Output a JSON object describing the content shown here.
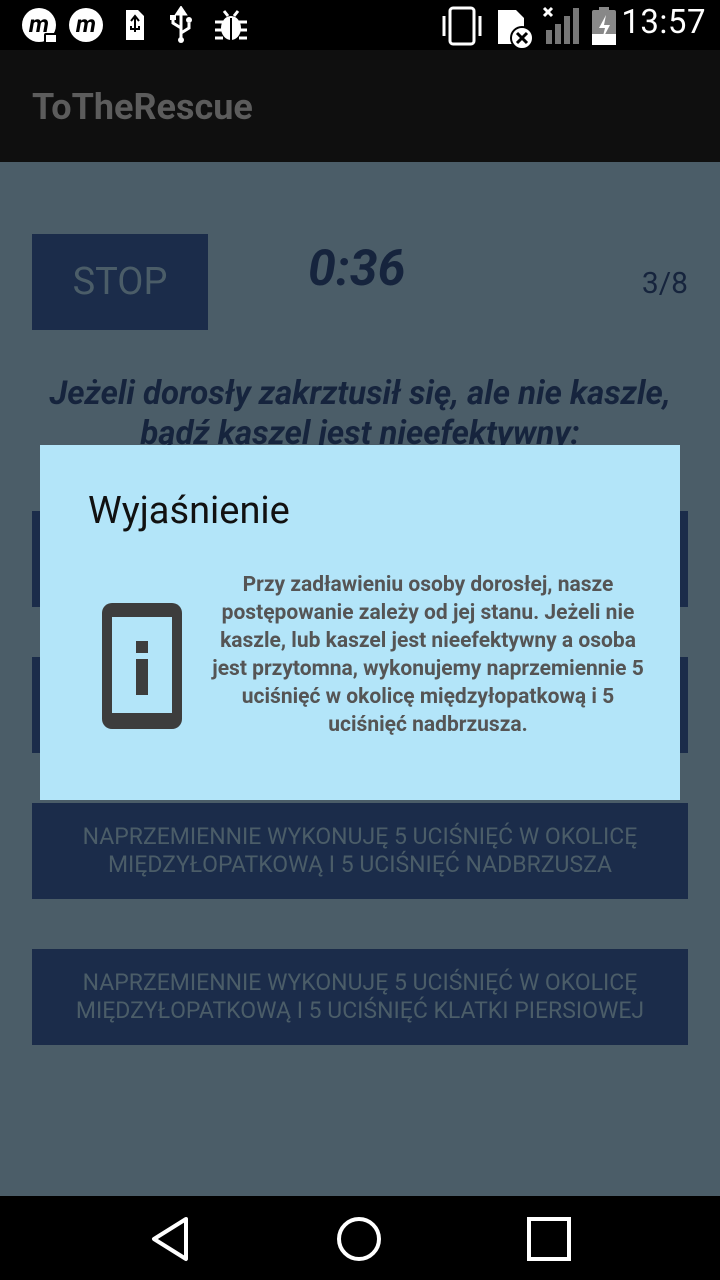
{
  "status_bar": {
    "time": "13:57",
    "left_icons": [
      "moto-camera-icon",
      "moto-icon",
      "usb-storage-icon",
      "usb-icon",
      "bug-icon"
    ],
    "right_icons": [
      "vibrate-icon",
      "sim-missing-icon",
      "signal-icon",
      "battery-charging-icon"
    ]
  },
  "action_bar": {
    "title": "ToTheRescue"
  },
  "screen": {
    "stop_label": "STOP",
    "timer": "0:36",
    "step": "3/8",
    "question": "Jeżeli dorosły zakrztusił się, ale nie kaszle, bądź kaszel jest nieefektywny:",
    "options": [
      {
        "label": ""
      },
      {
        "label": ""
      },
      {
        "label": "NAPRZEMIENNIE WYKONUJĘ 5 UCIŚNIĘĆ W OKOLICĘ MIĘDZYŁOPATKOWĄ I 5 UCIŚNIĘĆ NADBRZUSZA"
      },
      {
        "label": "NAPRZEMIENNIE WYKONUJĘ 5 UCIŚNIĘĆ W OKOLICĘ MIĘDZYŁOPATKOWĄ I 5 UCIŚNIĘĆ KLATKI PIERSIOWEJ"
      }
    ]
  },
  "dialog": {
    "title": "Wyjaśnienie",
    "icon": "info-phone-icon",
    "text": "Przy zadławieniu osoby dorosłej, nasze postępowanie zależy od jej stanu. Jeżeli nie kaszle, lub kaszel jest nieefektywny a osoba jest przytomna, wykonujemy naprzemiennie 5 uciśnięć w okolicę międzyłopatkową i 5 uciśnięć nadbrzusza."
  },
  "nav_bar": {
    "icons": [
      "back-icon",
      "home-icon",
      "recents-icon"
    ]
  },
  "colors": {
    "dim_background": "#4b5d68",
    "button_bg": "#1b2c4a",
    "dialog_bg": "#b3e5f9"
  }
}
